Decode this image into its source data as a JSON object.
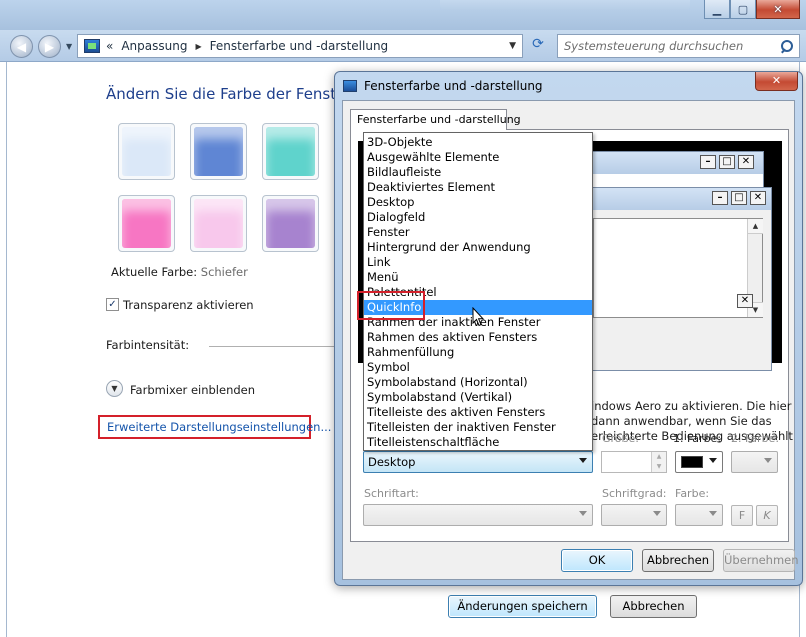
{
  "outer_window": {
    "breadcrumb": [
      "Anpassung",
      "Fensterfarbe und -darstellung"
    ],
    "breadcrumb_prefix": "«",
    "search_placeholder": "Systemsteuerung durchsuchen",
    "heading": "Ändern Sie die Farbe der Fenster",
    "current_color_label": "Aktuelle Farbe:",
    "current_color_value": "Schiefer",
    "transparency_label": "Transparenz aktivieren",
    "transparency_checked": true,
    "intensity_label": "Farbintensität:",
    "mixer_label": "Farbmixer einblenden",
    "advanced_link": "Erweiterte Darstellungseinstellungen...",
    "save_button": "Änderungen speichern",
    "cancel_button": "Abbrechen",
    "swatch_colors": [
      "#dbe8f8",
      "#5f86d4",
      "#5fd3cc",
      "#f776c3",
      "#f8c8ec",
      "#a783cf"
    ]
  },
  "dialog": {
    "title": "Fensterfarbe und -darstellung",
    "tab_label": "Fensterfarbe und -darstellung",
    "description_lines": [
      "indows Aero zu aktivieren. Die hier",
      "dann anwendbar, wenn Sie das",
      "erleichterte Bedienung ausgewählt"
    ],
    "element_select_value": "Desktop",
    "size_label": "Größe:",
    "color1_label": "1. Farbe:",
    "color2_label": "2. Farbe:",
    "font_label": "Schriftart:",
    "font_size_label": "Schriftgrad:",
    "font_color_label": "Farbe:",
    "bold_button": "F",
    "italic_button": "K",
    "ok_button": "OK",
    "cancel_button": "Abbrechen",
    "apply_button": "Übernehmen",
    "color1_swatch": "#000000"
  },
  "dropdown": {
    "items": [
      "3D-Objekte",
      "Ausgewählte Elemente",
      "Bildlaufleiste",
      "Deaktiviertes Element",
      "Desktop",
      "Dialogfeld",
      "Fenster",
      "Hintergrund der Anwendung",
      "Link",
      "Menü",
      "Palettentitel",
      "QuickInfo",
      "Rahmen der inaktiven Fenster",
      "Rahmen des aktiven Fensters",
      "Rahmenfüllung",
      "Symbol",
      "Symbolabstand (Horizontal)",
      "Symbolabstand (Vertikal)",
      "Titelleiste des aktiven Fensters",
      "Titelleisten der inaktiven Fenster",
      "Titelleistenschaltfläche"
    ],
    "selected": "QuickInfo",
    "highlight_color": "#3399ff",
    "annotation_color": "#d4202a"
  }
}
